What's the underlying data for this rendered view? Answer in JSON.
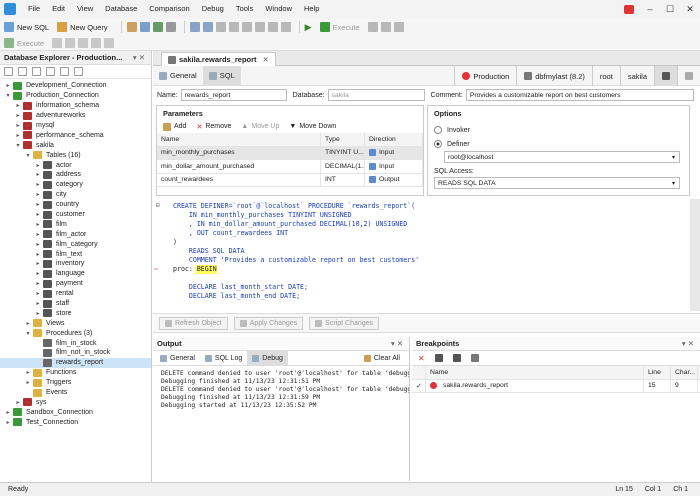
{
  "menu": {
    "items": [
      "File",
      "Edit",
      "View",
      "Database",
      "Comparison",
      "Debug",
      "Tools",
      "Window",
      "Help"
    ]
  },
  "toolbar": {
    "new_sql": "New SQL",
    "new_query": "New Query",
    "execute": "Execute",
    "execute2": "Execute"
  },
  "explorer": {
    "title": "Database Explorer - Production...",
    "tree": [
      {
        "depth": 0,
        "toggle": "▸",
        "label": "Development_Connection",
        "icon": "connection-icon",
        "color": "#3a9a3a"
      },
      {
        "depth": 0,
        "toggle": "▾",
        "label": "Production_Connection",
        "icon": "connection-icon",
        "color": "#3a9a3a"
      },
      {
        "depth": 1,
        "toggle": "▸",
        "label": "information_schema",
        "icon": "database-icon",
        "color": "#b03030"
      },
      {
        "depth": 1,
        "toggle": "▸",
        "label": "adventureworks",
        "icon": "database-icon",
        "color": "#b03030"
      },
      {
        "depth": 1,
        "toggle": "▸",
        "label": "mysql",
        "icon": "database-icon",
        "color": "#b03030"
      },
      {
        "depth": 1,
        "toggle": "▸",
        "label": "performance_schema",
        "icon": "database-icon",
        "color": "#b03030"
      },
      {
        "depth": 1,
        "toggle": "▾",
        "label": "sakila",
        "icon": "database-icon",
        "color": "#b03030"
      },
      {
        "depth": 2,
        "toggle": "▾",
        "label": "Tables (16)",
        "icon": "folder-icon",
        "color": "#e0b040"
      },
      {
        "depth": 3,
        "toggle": "▸",
        "label": "actor",
        "icon": "table-icon",
        "color": "#555"
      },
      {
        "depth": 3,
        "toggle": "▸",
        "label": "address",
        "icon": "table-icon",
        "color": "#555"
      },
      {
        "depth": 3,
        "toggle": "▸",
        "label": "category",
        "icon": "table-icon",
        "color": "#555"
      },
      {
        "depth": 3,
        "toggle": "▸",
        "label": "city",
        "icon": "table-icon",
        "color": "#555"
      },
      {
        "depth": 3,
        "toggle": "▸",
        "label": "country",
        "icon": "table-icon",
        "color": "#555"
      },
      {
        "depth": 3,
        "toggle": "▸",
        "label": "customer",
        "icon": "table-icon",
        "color": "#555"
      },
      {
        "depth": 3,
        "toggle": "▸",
        "label": "film",
        "icon": "table-icon",
        "color": "#555"
      },
      {
        "depth": 3,
        "toggle": "▸",
        "label": "film_actor",
        "icon": "table-icon",
        "color": "#555"
      },
      {
        "depth": 3,
        "toggle": "▸",
        "label": "film_category",
        "icon": "table-icon",
        "color": "#555"
      },
      {
        "depth": 3,
        "toggle": "▸",
        "label": "film_text",
        "icon": "table-icon",
        "color": "#555"
      },
      {
        "depth": 3,
        "toggle": "▸",
        "label": "inventory",
        "icon": "table-icon",
        "color": "#555"
      },
      {
        "depth": 3,
        "toggle": "▸",
        "label": "language",
        "icon": "table-icon",
        "color": "#555"
      },
      {
        "depth": 3,
        "toggle": "▸",
        "label": "payment",
        "icon": "table-icon",
        "color": "#555"
      },
      {
        "depth": 3,
        "toggle": "▸",
        "label": "rental",
        "icon": "table-icon",
        "color": "#555"
      },
      {
        "depth": 3,
        "toggle": "▸",
        "label": "staff",
        "icon": "table-icon",
        "color": "#555"
      },
      {
        "depth": 3,
        "toggle": "▸",
        "label": "store",
        "icon": "table-icon",
        "color": "#555"
      },
      {
        "depth": 2,
        "toggle": "▸",
        "label": "Views",
        "icon": "folder-icon",
        "color": "#e0b040"
      },
      {
        "depth": 2,
        "toggle": "▾",
        "label": "Procedures (3)",
        "icon": "folder-icon",
        "color": "#e0b040"
      },
      {
        "depth": 3,
        "toggle": "",
        "label": "film_in_stock",
        "icon": "procedure-icon",
        "color": "#666"
      },
      {
        "depth": 3,
        "toggle": "",
        "label": "film_not_in_stock",
        "icon": "procedure-icon",
        "color": "#666"
      },
      {
        "depth": 3,
        "toggle": "",
        "label": "rewards_report",
        "icon": "procedure-icon",
        "color": "#666",
        "selected": true
      },
      {
        "depth": 2,
        "toggle": "▸",
        "label": "Functions",
        "icon": "folder-icon",
        "color": "#e0b040"
      },
      {
        "depth": 2,
        "toggle": "▸",
        "label": "Triggers",
        "icon": "folder-icon",
        "color": "#e0b040"
      },
      {
        "depth": 2,
        "toggle": "",
        "label": "Events",
        "icon": "folder-icon",
        "color": "#e0b040"
      },
      {
        "depth": 1,
        "toggle": "▸",
        "label": "sys",
        "icon": "database-icon",
        "color": "#b03030"
      },
      {
        "depth": 0,
        "toggle": "▸",
        "label": "Sandbox_Connection",
        "icon": "connection-icon",
        "color": "#3a9a3a"
      },
      {
        "depth": 0,
        "toggle": "▸",
        "label": "Test_Connection",
        "icon": "connection-icon",
        "color": "#3a9a3a"
      }
    ]
  },
  "doc": {
    "tab_label": "sakila.rewards_report",
    "subtabs": {
      "general": "General",
      "sql": "SQL"
    },
    "connection": {
      "env": "Production",
      "server": "dbfmylast (8.2)",
      "user": "root",
      "db": "sakila"
    },
    "name_label": "Name:",
    "name_value": "rewards_report",
    "database_label": "Database:",
    "database_value": "sakila",
    "comment_label": "Comment:",
    "comment_value": "Provides a customizable report on best customers"
  },
  "params": {
    "title": "Parameters",
    "add": "Add",
    "remove": "Remove",
    "move_up": "Move Up",
    "move_down": "Move Down",
    "headers": [
      "Name",
      "Type",
      "Direction"
    ],
    "rows": [
      [
        "min_monthly_purchases",
        "TINYINT U...",
        "Input"
      ],
      [
        "min_dollar_amount_purchased",
        "DECIMAL(1...",
        "Input"
      ],
      [
        "count_rewardees",
        "INT",
        "Output"
      ]
    ]
  },
  "options": {
    "title": "Options",
    "invoker": "Invoker",
    "definer": "Definer",
    "definer_value": "root@localhost",
    "sql_access_label": "SQL Access:",
    "sql_access_value": "READS SQL DATA"
  },
  "code": {
    "lines": [
      "CREATE DEFINER=`root`@`localhost` PROCEDURE `rewards_report`(",
      "    IN min_monthly_purchases TINYINT UNSIGNED",
      "    , IN min_dollar_amount_purchased DECIMAL(10,2) UNSIGNED",
      "    , OUT count_rewardees INT",
      ")",
      "    READS SQL DATA",
      "    COMMENT 'Provides a customizable report on best customers'",
      "proc: BEGIN",
      "",
      "    DECLARE last_month_start DATE;",
      "    DECLARE last_month_end DATE;"
    ]
  },
  "buttons": {
    "refresh": "Refresh Object",
    "apply": "Apply Changes",
    "script": "Script Changes"
  },
  "output": {
    "title": "Output",
    "tabs": [
      "General",
      "SQL Log",
      "Debug"
    ],
    "clear_all": "Clear All",
    "lines": [
      "DELETE command denied to user 'root'@'localhost' for table 'debuggin",
      "Debugging finished at 11/13/23 12:31:51 PM",
      "DELETE command denied to user 'root'@'localhost' for table 'debuggin",
      "Debugging finished at 11/13/23 12:31:59 PM",
      "Debugging started at 11/13/23 12:35:52 PM"
    ]
  },
  "breakpoints": {
    "title": "Breakpoints",
    "headers": [
      "Name",
      "Line",
      "Char..."
    ],
    "rows": [
      [
        "sakila.rewards_report",
        "15",
        "9"
      ]
    ]
  },
  "status": {
    "ready": "Ready",
    "ln": "Ln 15",
    "col": "Col 1",
    "ch": "Ch 1"
  }
}
